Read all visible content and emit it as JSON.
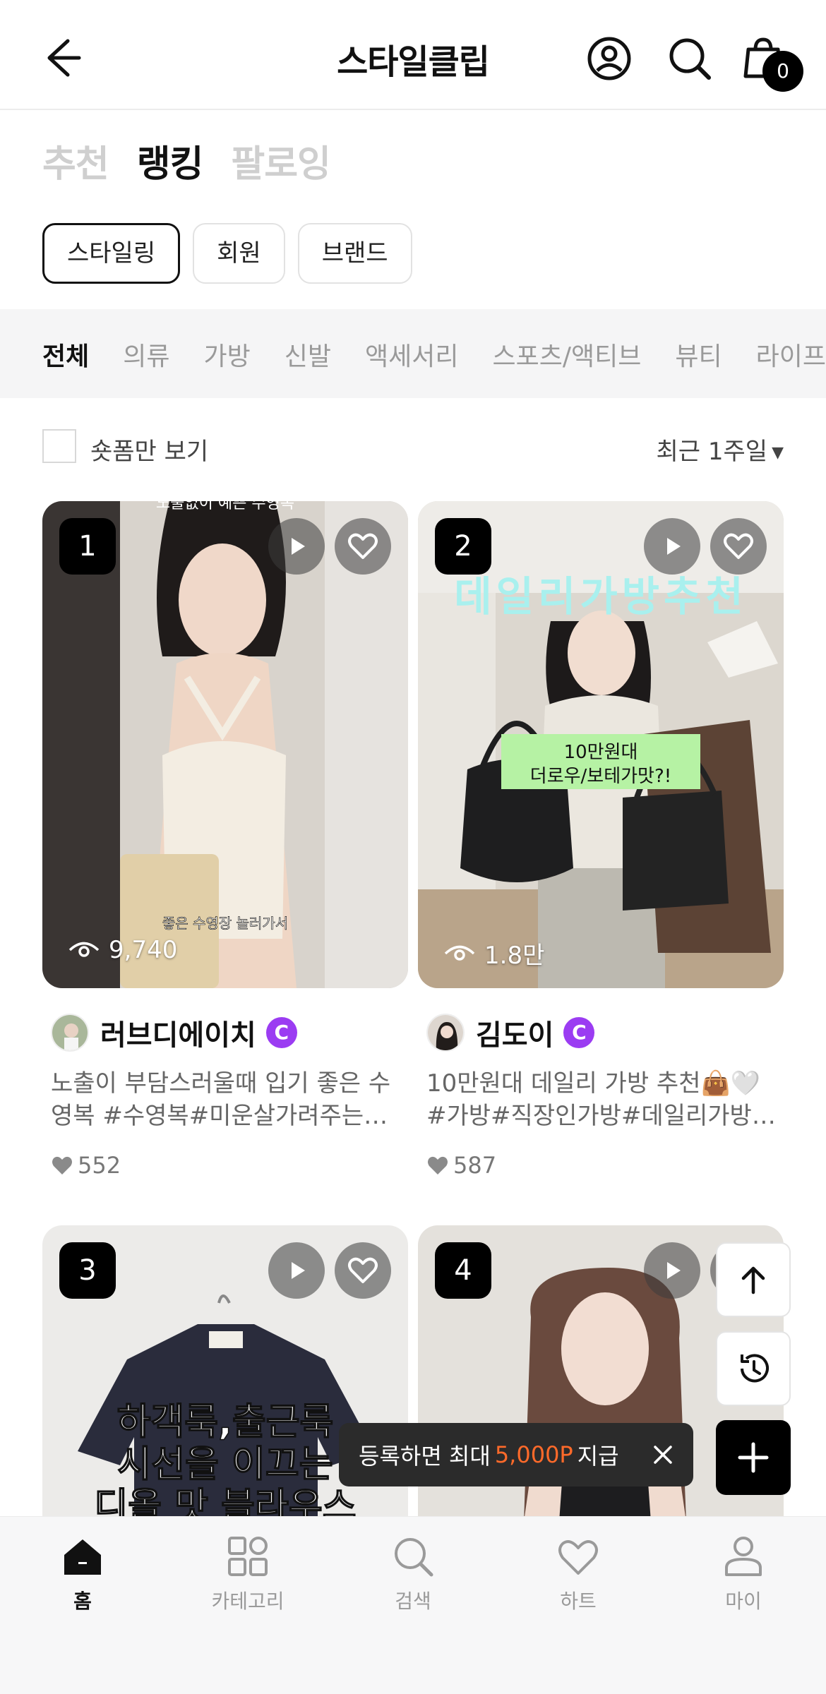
{
  "header": {
    "title": "스타일클립",
    "cart_count": "0"
  },
  "top_tabs": [
    "추천",
    "랭킹",
    "팔로잉"
  ],
  "active_top_tab": "랭킹",
  "chips": [
    "스타일링",
    "회원",
    "브랜드"
  ],
  "active_chip": "스타일링",
  "categories": [
    "전체",
    "의류",
    "가방",
    "신발",
    "액세서리",
    "스포츠/액티브",
    "뷰티",
    "라이프"
  ],
  "active_category": "전체",
  "options": {
    "shop_only_label": "숏폼만 보기",
    "period_label": "최근 1주일"
  },
  "cards": [
    {
      "rank": "1",
      "views": "9,740",
      "author": "러브디에이치",
      "badge": "C",
      "desc_line1": "노출이 부담스러울때 입기 좋은 수",
      "desc_line2": "영복 #수영복#미운살가려주는수영복",
      "likes": "552",
      "overlay_top": "노출없이 예쁜 수영복",
      "overlay_bottom": "좋은 수영장 놀러가서"
    },
    {
      "rank": "2",
      "views": "1.8만",
      "author": "김도이",
      "badge": "C",
      "desc_line1": "10만원대 데일리 가방 추천👜🤍",
      "desc_line2": "#가방#직장인가방#데일리가방#추천",
      "likes": "587",
      "overlay_title": "데일리가방추천",
      "overlay_caption_1": "10만원대",
      "overlay_caption_2": "더로우/보테가맛?!"
    },
    {
      "rank": "3",
      "overlay_text_1": "하객룩,출근룩",
      "overlay_text_2": "시선을 이끄는",
      "overlay_text_3": "디올 맛 블라우스"
    },
    {
      "rank": "4"
    }
  ],
  "toast": {
    "prefix": "등록하면 최대",
    "amount": "5,000P",
    "suffix": "지급"
  },
  "bottom_nav": [
    "홈",
    "카테고리",
    "검색",
    "하트",
    "마이"
  ],
  "active_nav": "홈",
  "colors": {
    "accent_orange": "#ff6a2a",
    "creator_purple": "#9b3cf2"
  }
}
